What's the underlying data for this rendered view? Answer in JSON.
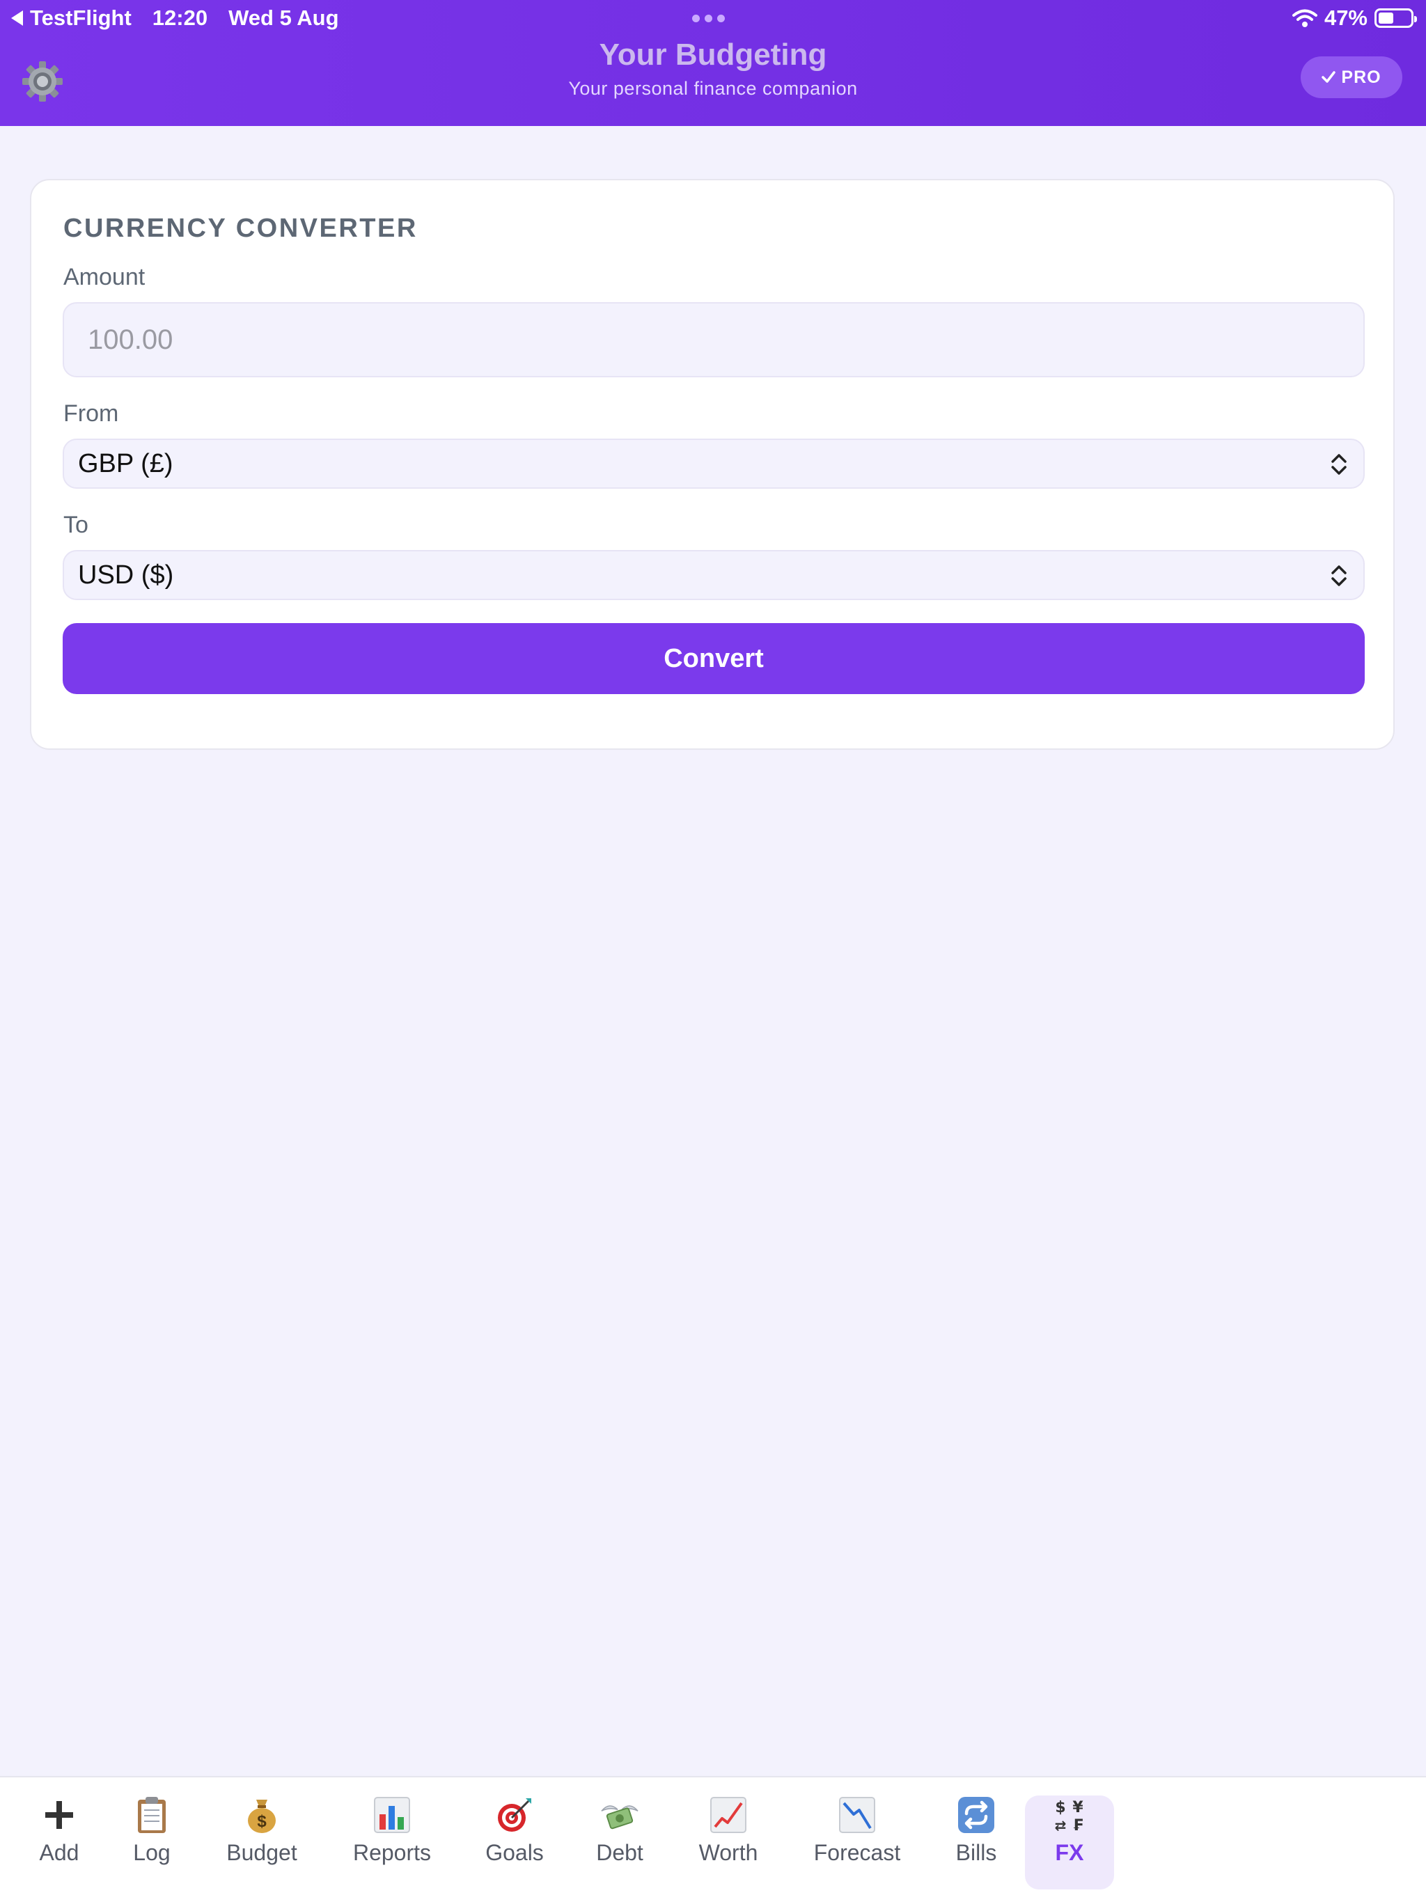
{
  "status_bar": {
    "back_app": "TestFlight",
    "time": "12:20",
    "date": "Wed 5 Aug",
    "battery": "47%",
    "battery_level": 0.47
  },
  "header": {
    "title": "Your Budgeting",
    "subtitle": "Your personal finance companion",
    "pro_label": "PRO",
    "settings_icon": "gear-icon"
  },
  "converter": {
    "title": "CURRENCY CONVERTER",
    "amount_label": "Amount",
    "amount_placeholder": "100.00",
    "from_label": "From",
    "from_value": "GBP (£)",
    "to_label": "To",
    "to_value": "USD ($)",
    "convert_label": "Convert"
  },
  "tabs": [
    {
      "label": "Add",
      "icon": "plus-icon"
    },
    {
      "label": "Log",
      "icon": "clipboard-icon"
    },
    {
      "label": "Budget",
      "icon": "money-bag-icon"
    },
    {
      "label": "Reports",
      "icon": "bar-chart-icon"
    },
    {
      "label": "Goals",
      "icon": "target-icon"
    },
    {
      "label": "Debt",
      "icon": "money-wings-icon"
    },
    {
      "label": "Worth",
      "icon": "chart-up-icon"
    },
    {
      "label": "Forecast",
      "icon": "chart-down-icon"
    },
    {
      "label": "Bills",
      "icon": "repeat-icon"
    },
    {
      "label": "FX",
      "icon": "currency-exchange-icon",
      "active": true
    }
  ],
  "colors": {
    "accent": "#7b3aec",
    "header": "#7a35ea",
    "background": "#f3f2fd"
  }
}
